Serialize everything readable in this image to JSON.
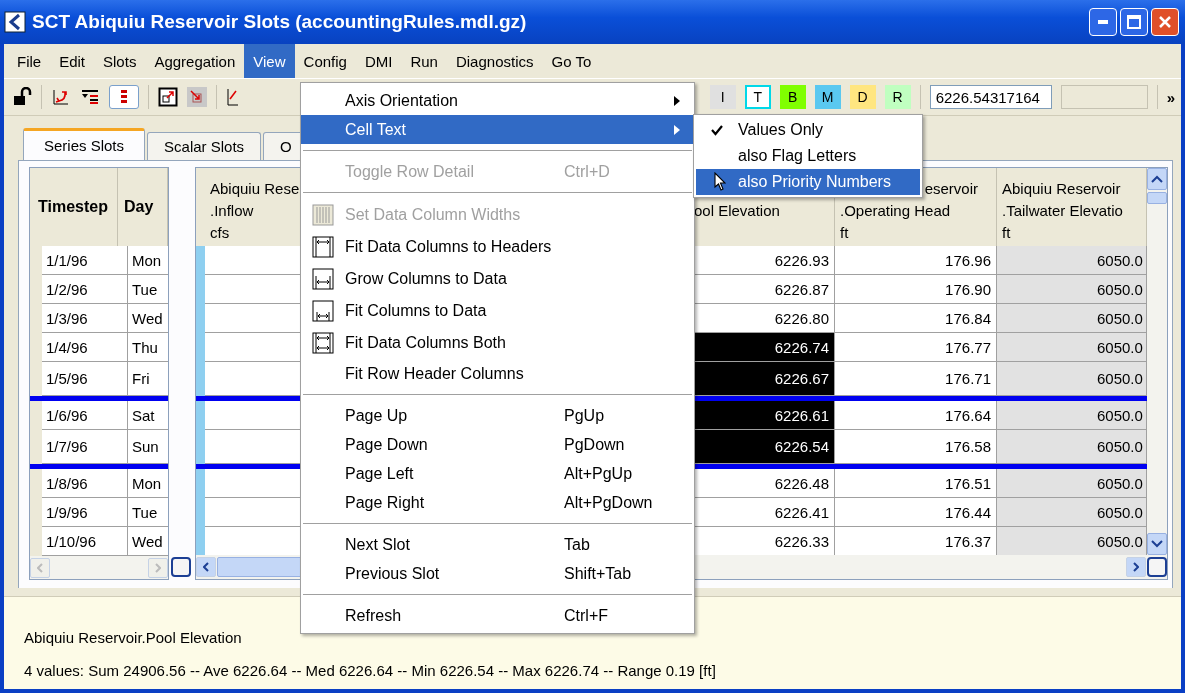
{
  "window": {
    "title": "SCT Abiquiu Reservoir Slots (accountingRules.mdl.gz)"
  },
  "menu_bar": [
    {
      "label": "File",
      "selected": false
    },
    {
      "label": "Edit",
      "selected": false
    },
    {
      "label": "Slots",
      "selected": false
    },
    {
      "label": "Aggregation",
      "selected": false
    },
    {
      "label": "View",
      "selected": true
    },
    {
      "label": "Config",
      "selected": false
    },
    {
      "label": "DMI",
      "selected": false
    },
    {
      "label": "Run",
      "selected": false
    },
    {
      "label": "Diagnostics",
      "selected": false
    },
    {
      "label": "Go To",
      "selected": false
    }
  ],
  "toolbar": {
    "flag_buttons": [
      {
        "label": "I",
        "color": "#e0e0e0",
        "selected": false
      },
      {
        "label": "T",
        "color": "#ffffff",
        "selected": true
      },
      {
        "label": "B",
        "color": "#80ff00",
        "selected": false
      },
      {
        "label": "M",
        "color": "#5ac8f0",
        "selected": false
      },
      {
        "label": "D",
        "color": "#ffe680",
        "selected": false
      },
      {
        "label": "R",
        "color": "#c0ffc0",
        "selected": false
      }
    ],
    "value_field": "6226.54317164",
    "overflow": "»"
  },
  "tabs": [
    {
      "label": "Series Slots",
      "selected": true
    },
    {
      "label": "Scalar Slots",
      "selected": false
    },
    {
      "label": "O",
      "selected": false
    }
  ],
  "row_header_columns": [
    "Timestep",
    "Day"
  ],
  "columns": [
    {
      "header": [
        "Abiquiu Rese",
        ".Inflow",
        "cfs"
      ],
      "kind": "inflow"
    },
    {
      "header": [
        "ool Elevation"
      ],
      "kind": "value"
    },
    {
      "header": [
        "eservoir",
        ".Operating Head",
        "ft"
      ],
      "kind": "value"
    },
    {
      "header": [
        "Abiquiu Reservoir",
        ".Tailwater Elevatio",
        "ft"
      ],
      "kind": "computed"
    }
  ],
  "rows": [
    {
      "date": "1/1/96",
      "day": "Mon",
      "values": [
        "6226.93",
        "176.96",
        "6050.0"
      ],
      "selected": [
        false,
        false,
        false
      ],
      "divider_after": false
    },
    {
      "date": "1/2/96",
      "day": "Tue",
      "values": [
        "6226.87",
        "176.90",
        "6050.0"
      ],
      "selected": [
        false,
        false,
        false
      ],
      "divider_after": false
    },
    {
      "date": "1/3/96",
      "day": "Wed",
      "values": [
        "6226.80",
        "176.84",
        "6050.0"
      ],
      "selected": [
        false,
        false,
        false
      ],
      "divider_after": false
    },
    {
      "date": "1/4/96",
      "day": "Thu",
      "values": [
        "6226.74",
        "176.77",
        "6050.0"
      ],
      "selected": [
        true,
        false,
        false
      ],
      "divider_after": false
    },
    {
      "date": "1/5/96",
      "day": "Fri",
      "values": [
        "6226.67",
        "176.71",
        "6050.0"
      ],
      "selected": [
        true,
        false,
        false
      ],
      "divider_after": true
    },
    {
      "date": "1/6/96",
      "day": "Sat",
      "values": [
        "6226.61",
        "176.64",
        "6050.0"
      ],
      "selected": [
        true,
        false,
        false
      ],
      "divider_after": false
    },
    {
      "date": "1/7/96",
      "day": "Sun",
      "values": [
        "6226.54",
        "176.58",
        "6050.0"
      ],
      "selected": [
        true,
        false,
        false
      ],
      "divider_after": true
    },
    {
      "date": "1/8/96",
      "day": "Mon",
      "values": [
        "6226.48",
        "176.51",
        "6050.0"
      ],
      "selected": [
        false,
        false,
        false
      ],
      "divider_after": false
    },
    {
      "date": "1/9/96",
      "day": "Tue",
      "values": [
        "6226.41",
        "176.44",
        "6050.0"
      ],
      "selected": [
        false,
        false,
        false
      ],
      "divider_after": false
    },
    {
      "date": "1/10/96",
      "day": "Wed",
      "values": [
        "6226.33",
        "176.37",
        "6050.0"
      ],
      "selected": [
        false,
        false,
        false
      ],
      "divider_after": false
    }
  ],
  "view_menu": [
    {
      "kind": "submenu",
      "label": "Axis Orientation",
      "selected": false,
      "disabled": false
    },
    {
      "kind": "submenu",
      "label": "Cell Text",
      "selected": true,
      "disabled": false
    },
    {
      "kind": "separator"
    },
    {
      "kind": "item",
      "label": "Toggle Row Detail",
      "shortcut": "Ctrl+D",
      "selected": false,
      "disabled": true
    },
    {
      "kind": "separator"
    },
    {
      "kind": "icon_item",
      "label": "Set Data Column Widths",
      "selected": false,
      "disabled": true
    },
    {
      "kind": "icon_item",
      "label": "Fit Data Columns to Headers",
      "selected": false,
      "disabled": false
    },
    {
      "kind": "icon_item",
      "label": "Grow Columns to Data",
      "selected": false,
      "disabled": false
    },
    {
      "kind": "icon_item",
      "label": "Fit Columns to Data",
      "selected": false,
      "disabled": false
    },
    {
      "kind": "icon_item",
      "label": "Fit Data Columns Both",
      "selected": false,
      "disabled": false
    },
    {
      "kind": "item",
      "label": "Fit Row Header Columns",
      "selected": false,
      "disabled": false
    },
    {
      "kind": "separator"
    },
    {
      "kind": "item",
      "label": "Page Up",
      "shortcut": "PgUp",
      "selected": false,
      "disabled": false
    },
    {
      "kind": "item",
      "label": "Page Down",
      "shortcut": "PgDown",
      "selected": false,
      "disabled": false
    },
    {
      "kind": "item",
      "label": "Page Left",
      "shortcut": "Alt+PgUp",
      "selected": false,
      "disabled": false
    },
    {
      "kind": "item",
      "label": "Page Right",
      "shortcut": "Alt+PgDown",
      "selected": false,
      "disabled": false
    },
    {
      "kind": "separator"
    },
    {
      "kind": "item",
      "label": "Next Slot",
      "shortcut": "Tab",
      "selected": false,
      "disabled": false
    },
    {
      "kind": "item",
      "label": "Previous Slot",
      "shortcut": "Shift+Tab",
      "selected": false,
      "disabled": false
    },
    {
      "kind": "separator"
    },
    {
      "kind": "item",
      "label": "Refresh",
      "shortcut": "Ctrl+F",
      "selected": false,
      "disabled": false
    }
  ],
  "cell_text_submenu": [
    {
      "label": "Values Only",
      "checked": true,
      "selected": false
    },
    {
      "label": "also Flag Letters",
      "checked": false,
      "selected": false
    },
    {
      "label": "also Priority Numbers",
      "checked": false,
      "selected": true
    }
  ],
  "status": {
    "slot": "Abiquiu Reservoir.Pool Elevation",
    "summary": "4 values:  Sum 24906.56 -- Ave 6226.64 -- Med 6226.64 -- Min 6226.54 -- Max 6226.74 -- Range 0.19 [ft]"
  }
}
